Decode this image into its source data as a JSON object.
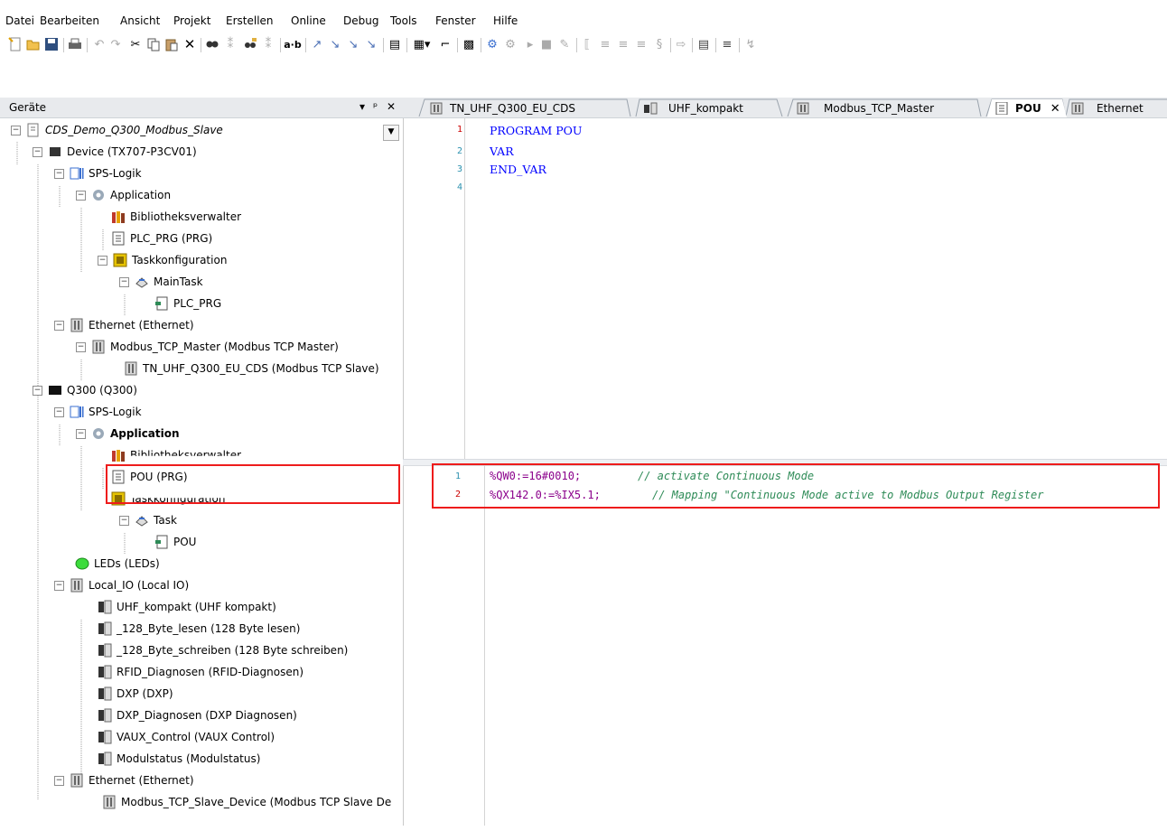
{
  "menu": [
    "Datei",
    "Bearbeiten",
    "Ansicht",
    "Projekt",
    "Erstellen",
    "Online",
    "Debug",
    "Tools",
    "Fenster",
    "Hilfe"
  ],
  "panel": {
    "title": "Geräte",
    "pin": "▾ ⊥ ✕"
  },
  "tree": [
    {
      "label": "CDS_Demo_Q300_Modbus_Slave",
      "italic": true
    },
    {
      "label": "Device (TX707-P3CV01)"
    },
    {
      "label": "SPS-Logik"
    },
    {
      "label": "Application"
    },
    {
      "label": "Bibliotheksverwalter"
    },
    {
      "label": "PLC_PRG (PRG)"
    },
    {
      "label": "Taskkonfiguration"
    },
    {
      "label": "MainTask"
    },
    {
      "label": "PLC_PRG"
    },
    {
      "label": "Ethernet (Ethernet)"
    },
    {
      "label": "Modbus_TCP_Master (Modbus TCP Master)"
    },
    {
      "label": "TN_UHF_Q300_EU_CDS (Modbus TCP Slave)"
    },
    {
      "label": "Q300 (Q300)"
    },
    {
      "label": "SPS-Logik"
    },
    {
      "label": "Application",
      "bold": true
    },
    {
      "label": "Bibliotheksverwalter"
    },
    {
      "label": "POU (PRG)"
    },
    {
      "label": "Taskkonfiguration"
    },
    {
      "label": "Task"
    },
    {
      "label": "POU"
    },
    {
      "label": "LEDs (LEDs)"
    },
    {
      "label": "Local_IO (Local IO)"
    },
    {
      "label": "UHF_kompakt (UHF kompakt)"
    },
    {
      "label": "_128_Byte_lesen (128 Byte lesen)"
    },
    {
      "label": "_128_Byte_schreiben (128 Byte schreiben)"
    },
    {
      "label": "RFID_Diagnosen (RFID-Diagnosen)"
    },
    {
      "label": "DXP (DXP)"
    },
    {
      "label": "DXP_Diagnosen (DXP Diagnosen)"
    },
    {
      "label": "VAUX_Control (VAUX Control)"
    },
    {
      "label": "Modulstatus (Modulstatus)"
    },
    {
      "label": "Ethernet (Ethernet)"
    },
    {
      "label": "Modbus_TCP_Slave_Device (Modbus TCP Slave De"
    }
  ],
  "tabs": [
    "TN_UHF_Q300_EU_CDS",
    "UHF_kompakt",
    "Modbus_TCP_Master",
    "POU",
    "Ethernet"
  ],
  "tab_close": "✕",
  "decl": {
    "lines": [
      "1",
      "2",
      "3",
      "4"
    ],
    "code": [
      "PROGRAM POU",
      "VAR",
      "END_VAR",
      ""
    ]
  },
  "impl": {
    "lines": [
      "1",
      "2"
    ],
    "code": [
      {
        "stmt": "%QW0:=16#0010;",
        "comment": "// activate Continuous Mode"
      },
      {
        "stmt": "%QX142.0:=%IX5.1;",
        "comment": "// Mapping \"Continuous Mode active to Modbus Output Register"
      }
    ]
  },
  "colors": {
    "highlight": "#ee1c1c",
    "keyword": "#0000ff",
    "comment": "#2e8b57",
    "address": "#8b008b"
  }
}
